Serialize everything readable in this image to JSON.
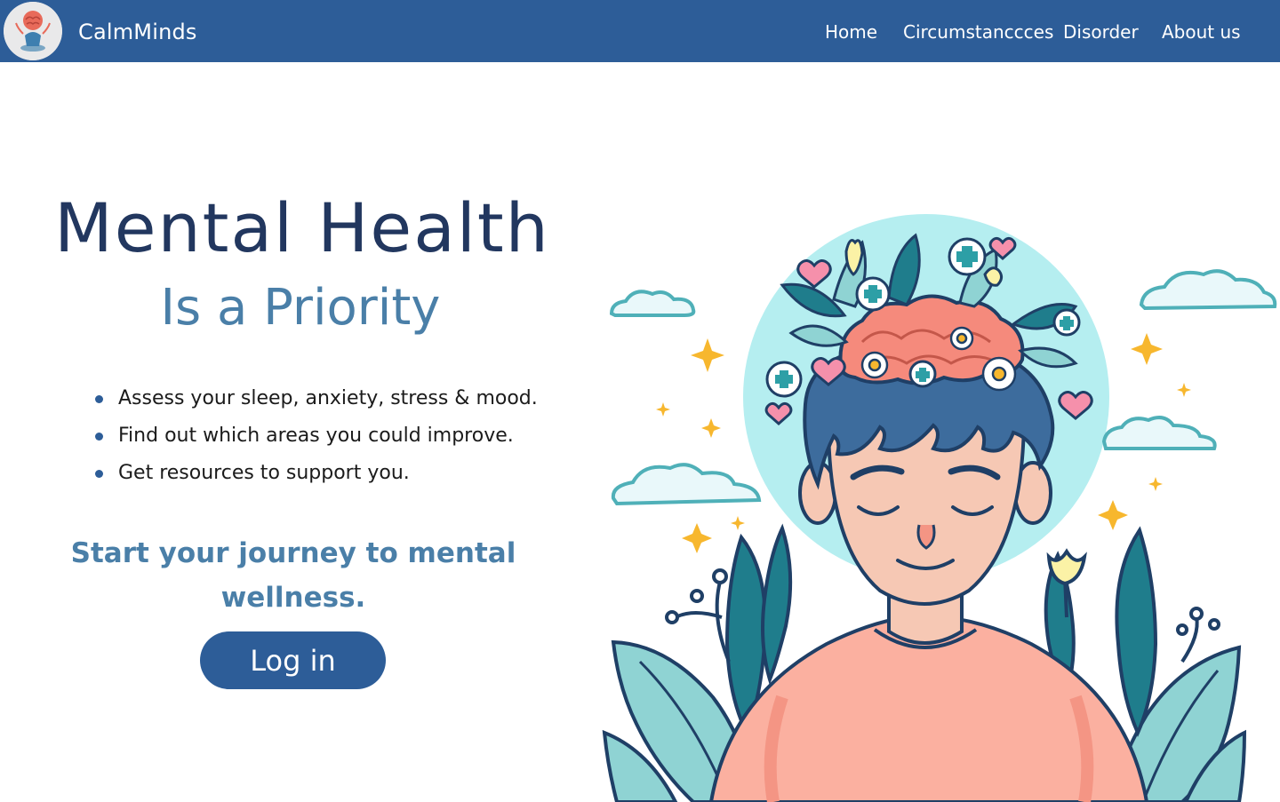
{
  "header": {
    "logo_icon": "meditating-brain-icon",
    "brand": "CalmMinds",
    "nav": [
      {
        "label": "Home"
      },
      {
        "label": "Circumstanccces"
      },
      {
        "label": "Disorder"
      },
      {
        "label": "About us"
      }
    ]
  },
  "hero": {
    "title": "Mental Health",
    "subtitle": "Is a Priority",
    "features": [
      "Assess your sleep, anxiety, stress & mood.",
      "Find out which areas you could improve.",
      "Get resources to support you."
    ],
    "cta_text": "Start your journey to mental wellness.",
    "login_label": "Log in"
  },
  "illustration": {
    "icon": "mindful-person-illustration"
  },
  "colors": {
    "nav_bg": "#2d5d98",
    "title": "#22375f",
    "accent": "#4a7fa8",
    "button": "#2d5d98",
    "halo": "#b5eef0",
    "shirt": "#fbb0a0",
    "hair": "#3d6c9d",
    "skin": "#f6c8b4",
    "leaf": "#8fd3d3",
    "sparkle": "#f7b72e"
  }
}
